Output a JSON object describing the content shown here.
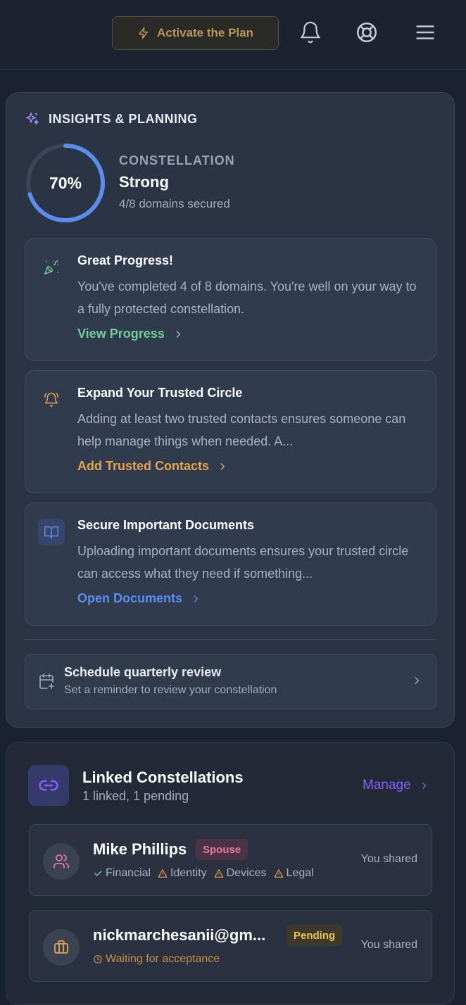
{
  "header": {
    "activate_label": "Activate the Plan",
    "icons": [
      "bell-icon",
      "lifebuoy-icon",
      "menu-icon"
    ]
  },
  "insights": {
    "title": "INSIGHTS & PLANNING",
    "progress_percent": 70,
    "progress_label": "70%",
    "constellation_label": "CONSTELLATION",
    "constellation_level": "Strong",
    "domains_text": "4/8 domains secured",
    "tips": [
      {
        "icon": "party-popper-icon",
        "title": "Great Progress!",
        "body": "You've completed 4 of 8 domains. You're well on your way to a fully protected constellation.",
        "link": "View Progress",
        "color": "#6fcf97"
      },
      {
        "icon": "bell-ring-icon",
        "title": "Expand Your Trusted Circle",
        "body": "Adding at least two trusted contacts ensures someone can help manage things when needed. A...",
        "link": "Add Trusted Contacts",
        "color": "#e8a24a"
      },
      {
        "icon": "book-open-icon",
        "title": "Secure Important Documents",
        "body": "Uploading important documents ensures your trusted circle can access what they need if something...",
        "link": "Open Documents",
        "color": "#5b8def"
      }
    ],
    "review": {
      "title": "Schedule quarterly review",
      "subtitle": "Set a reminder to review your constellation"
    }
  },
  "linked": {
    "title": "Linked Constellations",
    "subtitle": "1 linked, 1 pending",
    "manage_label": "Manage",
    "members": [
      {
        "name": "Mike Phillips",
        "badge": "Spouse",
        "statuses": [
          {
            "label": "Financial",
            "state": "ok"
          },
          {
            "label": "Identity",
            "state": "warn"
          },
          {
            "label": "Devices",
            "state": "warn"
          },
          {
            "label": "Legal",
            "state": "warn"
          }
        ],
        "shared": "You shared"
      },
      {
        "name": "nickmarchesanii@gm...",
        "badge": "Pending",
        "waiting": "Waiting for acceptance",
        "shared": "You shared"
      }
    ]
  },
  "colors": {
    "accent_blue": "#5b8def",
    "accent_purple": "#8b5cf6",
    "success": "#6fcf97",
    "warning": "#e8a24a",
    "pink": "#e879a6"
  }
}
